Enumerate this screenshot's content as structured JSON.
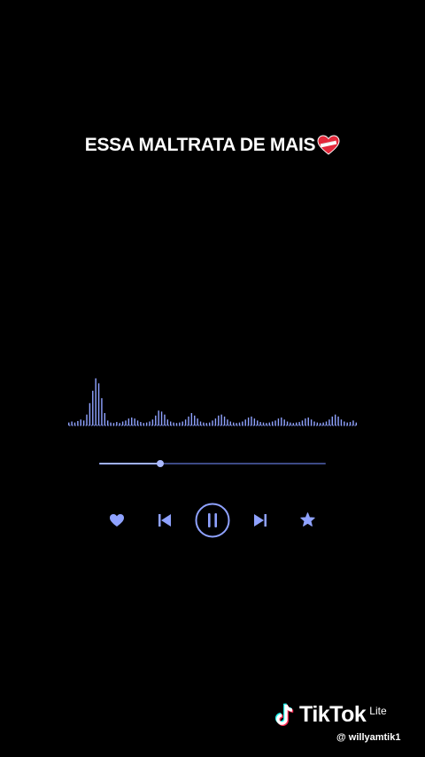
{
  "caption": {
    "text": "ESSA MALTRATA DE MAIS",
    "emoji": "mending-heart-icon"
  },
  "player": {
    "accent_color": "#8fa2ff",
    "track_color": "#3d4a86",
    "progress": 0.27,
    "waveform_levels": [
      0.06,
      0.08,
      0.06,
      0.09,
      0.12,
      0.1,
      0.22,
      0.45,
      0.7,
      0.95,
      0.85,
      0.55,
      0.25,
      0.1,
      0.06,
      0.05,
      0.07,
      0.05,
      0.08,
      0.1,
      0.14,
      0.16,
      0.14,
      0.1,
      0.07,
      0.05,
      0.06,
      0.08,
      0.12,
      0.2,
      0.3,
      0.28,
      0.22,
      0.12,
      0.08,
      0.06,
      0.05,
      0.06,
      0.08,
      0.12,
      0.18,
      0.25,
      0.2,
      0.14,
      0.08,
      0.06,
      0.05,
      0.06,
      0.1,
      0.14,
      0.2,
      0.22,
      0.18,
      0.12,
      0.08,
      0.06,
      0.05,
      0.06,
      0.08,
      0.12,
      0.16,
      0.18,
      0.14,
      0.1,
      0.07,
      0.06,
      0.05,
      0.06,
      0.08,
      0.1,
      0.14,
      0.16,
      0.12,
      0.08,
      0.06,
      0.05,
      0.06,
      0.07,
      0.1,
      0.14,
      0.16,
      0.12,
      0.08,
      0.06,
      0.05,
      0.06,
      0.08,
      0.12,
      0.18,
      0.22,
      0.18,
      0.12,
      0.08,
      0.06,
      0.07,
      0.1,
      0.06
    ],
    "controls": {
      "like": "heart-icon",
      "previous": "skip-previous-icon",
      "play_pause": "pause-icon",
      "next": "skip-next-icon",
      "favorite": "star-icon"
    }
  },
  "watermark": {
    "brand": "TikTok",
    "edition": "Lite",
    "handle": "@ willyamtik1"
  }
}
